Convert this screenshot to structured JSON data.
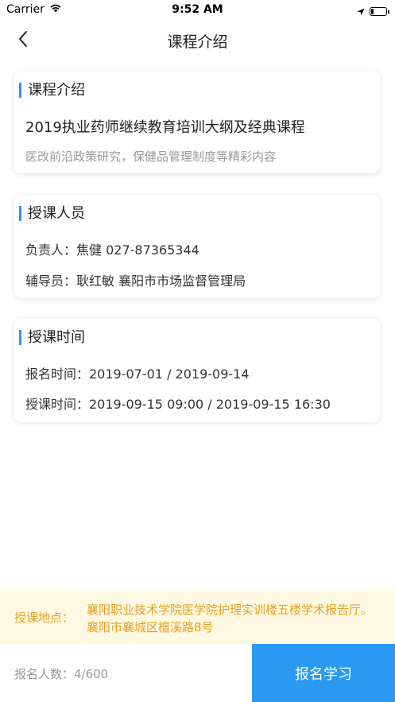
{
  "status_bar": {
    "carrier": "Carrier",
    "time": "9:52 AM",
    "icons": [
      "wifi-icon",
      "location-arrow-icon",
      "battery-icon"
    ]
  },
  "nav": {
    "title": "课程介绍",
    "back_icon": "chevron-left-icon"
  },
  "intro": {
    "heading": "课程介绍",
    "course_name": "2019执业药师继续教育培训大纲及经典课程",
    "summary": "医改前沿政策研究，保健品管理制度等精彩内容"
  },
  "instructors": {
    "heading": "授课人员",
    "lead": "负责人：焦健 027-87365344",
    "tutor": "辅导员：耿红敏 襄阳市市场监督管理局"
  },
  "schedule": {
    "heading": "授课时间",
    "registration": "报名时间：2019-07-01 / 2019-09-14",
    "lecture": "授课时间：2019-09-15 09:00 / 2019-09-15 16:30"
  },
  "location": {
    "label": "授课地点：",
    "address": "襄阳职业技术学院医学院护理实训楼五楼学术报告厅。襄阳市襄城区檀溪路8号"
  },
  "bottom": {
    "enroll_count": "报名人数：4/600",
    "enroll_button": "报名学习"
  },
  "colors": {
    "accent": "#2b9af3",
    "location_text": "#e8a020",
    "location_bg": "#fff9e3"
  }
}
